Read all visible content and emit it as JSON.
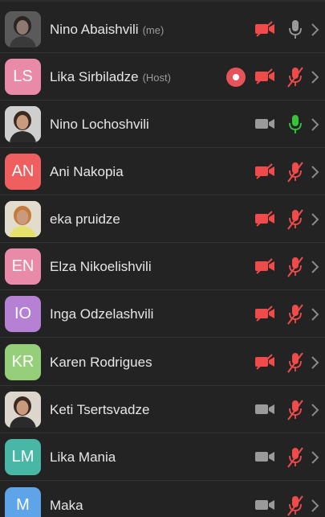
{
  "participants": [
    {
      "name": "Nino Abaishvili",
      "tag": "(me)",
      "initials": "",
      "avatar_color": "#5a5a5a",
      "photo": "photo-dark",
      "recording": false,
      "camera": "off",
      "mic": "neutral"
    },
    {
      "name": "Lika Sirbiladze",
      "tag": "(Host)",
      "initials": "LS",
      "avatar_color": "#e98aa9",
      "photo": "",
      "recording": true,
      "camera": "off",
      "mic": "muted"
    },
    {
      "name": "Nino Lochoshvili",
      "tag": "",
      "initials": "",
      "avatar_color": "#cfcfcf",
      "photo": "photo-light",
      "recording": false,
      "camera": "available",
      "mic": "active"
    },
    {
      "name": "Ani Nakopia",
      "tag": "",
      "initials": "AN",
      "avatar_color": "#ef5f5f",
      "photo": "",
      "recording": false,
      "camera": "off",
      "mic": "muted"
    },
    {
      "name": "eka pruidze",
      "tag": "",
      "initials": "",
      "avatar_color": "#e2dccd",
      "photo": "photo-yellow",
      "recording": false,
      "camera": "off",
      "mic": "muted"
    },
    {
      "name": "Elza Nikoelishvili",
      "tag": "",
      "initials": "EN",
      "avatar_color": "#e98aa9",
      "photo": "",
      "recording": false,
      "camera": "off",
      "mic": "muted"
    },
    {
      "name": "Inga Odzelashvili",
      "tag": "",
      "initials": "IO",
      "avatar_color": "#b681d4",
      "photo": "",
      "recording": false,
      "camera": "off",
      "mic": "muted"
    },
    {
      "name": "Karen Rodrigues",
      "tag": "",
      "initials": "KR",
      "avatar_color": "#96cf7a",
      "photo": "",
      "recording": false,
      "camera": "off",
      "mic": "muted"
    },
    {
      "name": "Keti Tsertsvadze",
      "tag": "",
      "initials": "",
      "avatar_color": "#dcd6cc",
      "photo": "photo-light",
      "recording": false,
      "camera": "available",
      "mic": "muted"
    },
    {
      "name": "Lika Mania",
      "tag": "",
      "initials": "LM",
      "avatar_color": "#49b7a6",
      "photo": "",
      "recording": false,
      "camera": "available",
      "mic": "muted"
    },
    {
      "name": "Maka",
      "tag": "",
      "initials": "M",
      "avatar_color": "#5da5e8",
      "photo": "",
      "recording": false,
      "camera": "available",
      "mic": "muted"
    }
  ],
  "colors": {
    "muted": "#ef4b4b",
    "active": "#38c43a",
    "neutral": "#9a9a9a",
    "chevron": "#8a8a8a"
  },
  "icons": {
    "recording": "record-dot-icon",
    "camera": "video-camera-icon",
    "mic": "microphone-icon",
    "chevron": "chevron-right-icon"
  }
}
